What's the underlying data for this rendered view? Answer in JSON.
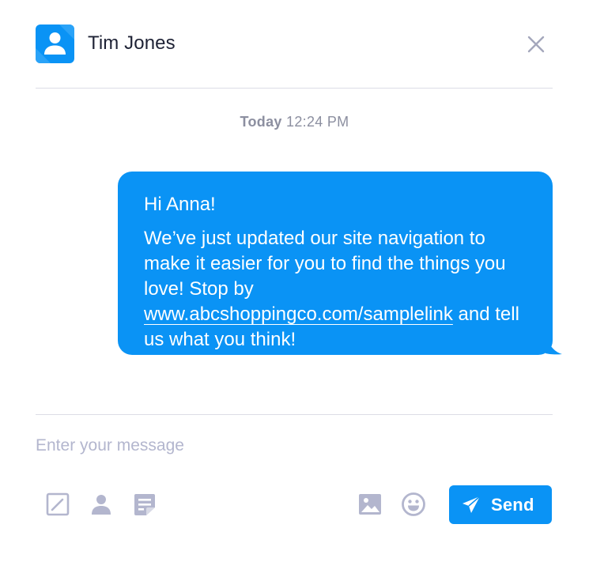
{
  "header": {
    "contact_name": "Tim Jones",
    "avatar_icon": "user-icon",
    "close_icon": "close-icon"
  },
  "timestamp": {
    "day": "Today",
    "time": "12:24 PM"
  },
  "message": {
    "greeting": "Hi Anna!",
    "body_before_link": "We’ve just updated our site navigation to make it easier for you to find the things you love! Stop by ",
    "link_text": "www.abcshoppingco.com/samplelink",
    "body_after_link": " and tell us what you think!"
  },
  "composer": {
    "placeholder": "Enter your message",
    "value": ""
  },
  "toolbar": {
    "left_icons": [
      "compose-icon",
      "contact-icon",
      "note-icon"
    ],
    "right_icons": [
      "image-icon",
      "emoji-icon"
    ],
    "send_label": "Send",
    "send_icon": "paper-plane-icon"
  },
  "colors": {
    "accent": "#0A93F5",
    "icon_gray": "#B3B6CE",
    "text_dark": "#1E2235",
    "timestamp": "#8C8FA0",
    "divider": "#DCDDE6"
  }
}
